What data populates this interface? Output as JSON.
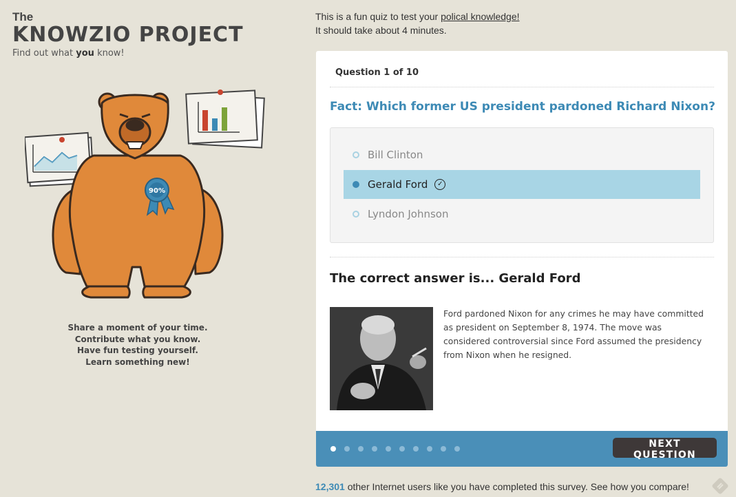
{
  "brand": {
    "the": "The",
    "title": "KNOWZIO PROJECT",
    "tagline_pre": "Find out what ",
    "tagline_bold": "you",
    "tagline_post": " know!"
  },
  "illustration": {
    "badge_text": "90%",
    "icons": [
      "bear-mascot",
      "line-chart-paper",
      "bar-chart-paper",
      "award-ribbon"
    ]
  },
  "share_lines": [
    "Share a moment of your time.",
    "Contribute what you know.",
    "Have fun testing yourself.",
    "Learn something new!"
  ],
  "intro": {
    "line1_pre": "This is a fun quiz to test your ",
    "line1_link": "polical knowledge!",
    "line2": "It should take about 4 minutes."
  },
  "quiz": {
    "question_counter": "Question 1 of 10",
    "question": "Fact: Which former US president pardoned Richard Nixon?",
    "options": [
      {
        "label": "Bill Clinton",
        "selected": false
      },
      {
        "label": "Gerald Ford",
        "selected": true
      },
      {
        "label": "Lyndon Johnson",
        "selected": false
      }
    ],
    "answer_title": "The correct answer is... Gerald Ford",
    "explanation": "Ford pardoned Nixon for any crimes he may have committed as president on September 8, 1974. The move was considered controversial since Ford assumed the presidency from Nixon when he resigned.",
    "progress": {
      "current": 1,
      "total": 10
    },
    "next_label": "NEXT QUESTION"
  },
  "bottom": {
    "count": "12,301",
    "text": " other Internet users like you have completed this survey. See how you compare!"
  },
  "colors": {
    "background": "#e6e3d8",
    "accent_blue": "#3d8ab5",
    "footer_blue": "#4a8fb8",
    "selected_row": "#a8d5e5",
    "bear_orange": "#e0893a",
    "button_dark": "#3e3838"
  }
}
